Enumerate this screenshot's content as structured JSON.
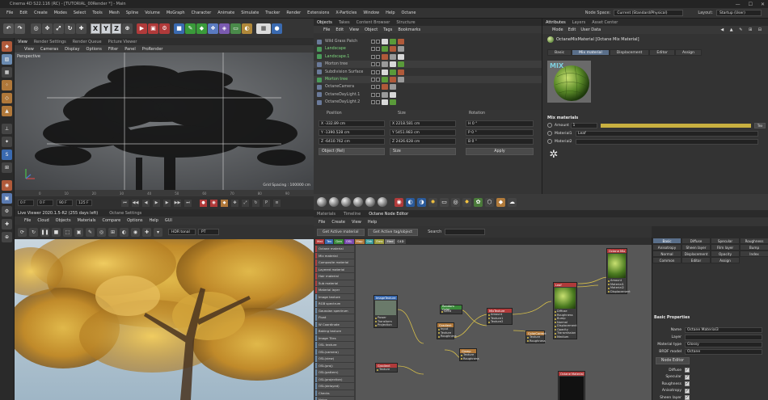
{
  "titlebar": {
    "title": "Cinema 4D S22.116 (RC) - [TUTORIAL_00Render *] - Main",
    "minimize": "—",
    "maximize": "☐",
    "close": "✕"
  },
  "menubar": {
    "items": [
      "File",
      "Edit",
      "Create",
      "Modes",
      "Select",
      "Tools",
      "Mesh",
      "Spline",
      "Volume",
      "MoGraph",
      "Character",
      "Animate",
      "Simulate",
      "Tracker",
      "Render",
      "Extensions",
      "X-Particles",
      "Window",
      "Help",
      "Octane"
    ],
    "node_space_label": "Node Space:",
    "node_space_value": "Current (Standard/Physical)",
    "layout_label": "Layout:",
    "layout_value": "Startup (User)"
  },
  "toolbar": {
    "x": "X",
    "y": "Y",
    "z": "Z"
  },
  "viewport": {
    "tabs": [
      "View",
      "Render Settings",
      "Render Queue",
      "Picture Viewer"
    ],
    "menu": [
      "View",
      "Cameras",
      "Display",
      "Options",
      "Filter",
      "Panel",
      "ProRender"
    ],
    "label": "Perspective",
    "grid_spacing": "Grid Spacing : 100000 cm"
  },
  "timeline": {
    "ticks": [
      "0",
      "10",
      "20",
      "30",
      "40",
      "50",
      "60",
      "70",
      "80",
      "90"
    ],
    "start": "0 F",
    "current": "0 F",
    "fps": "90 F",
    "end": "125 F"
  },
  "liveviewer": {
    "tabs": [
      "Live Viewer 2020.1.5-R2 (255 days left)",
      "Octane Settings"
    ],
    "menu": [
      "File",
      "Cloud",
      "Objects",
      "Materials",
      "Compare",
      "Options",
      "Help",
      "GUI"
    ],
    "hdr_mode": "HDR tonal",
    "pt_mode": "PT"
  },
  "objects": {
    "tabs": [
      "Objects",
      "Takes",
      "Content Browser",
      "Structure",
      "Layers",
      "Asset Center"
    ],
    "menu": [
      "File",
      "Edit",
      "View",
      "Object",
      "Tags",
      "Bookmarks"
    ],
    "rows": [
      {
        "name": "Wild Grass Patch",
        "color": "#b8b8b8"
      },
      {
        "name": "Landscape",
        "color": "#7ed87e"
      },
      {
        "name": "Landscape.1",
        "color": "#7ed87e"
      },
      {
        "name": "Morton tree",
        "color": "#b8b8b8"
      },
      {
        "name": "Subdivision Surface",
        "color": "#b8b8b8"
      },
      {
        "name": "Morton tree",
        "color": "#7ed87e"
      },
      {
        "name": "OctaneCamera",
        "color": "#b8b8b8"
      },
      {
        "name": "OctaneDayLight.1",
        "color": "#b8b8b8"
      },
      {
        "name": "OctaneDayLight.2",
        "color": "#b8b8b8"
      }
    ]
  },
  "coords": {
    "position_label": "Position",
    "size_label": "Size",
    "rotation_label": "Rotation",
    "position": [
      "X  -332.89 cm",
      "Y  -1390.528 cm",
      "Z  -6410.762 cm"
    ],
    "size": [
      "X  2218.581 cm",
      "Y  5451.983 cm",
      "Z  2426.628 cm"
    ],
    "rotation": [
      "H  0 °",
      "P  0 °",
      "B  0 °"
    ],
    "mode_object": "Object (Rel)",
    "mode_size": "Size",
    "apply": "Apply"
  },
  "attributes": {
    "tabs": [
      "Attributes",
      "Layers",
      "Asset Center"
    ],
    "menu": [
      "Mode",
      "Edit",
      "User Data"
    ],
    "title": "OctaneMixMaterial [Octane Mix Material]",
    "mattabs": [
      "Basic",
      "Mix material",
      "Displacement",
      "Editor",
      "Assign"
    ],
    "preview_label": "MIX",
    "mix_header": "Mix materials",
    "amount_label": "Amount",
    "amount_value": "1",
    "tex_button": "Tex",
    "material1_label": "Material1",
    "material1_value": "Leaf",
    "material2_label": "Material2"
  },
  "nodeeditor": {
    "tabs": [
      "Materials",
      "Timeline",
      "Octane Node Editor"
    ],
    "menu": [
      "File",
      "Create",
      "View",
      "Help"
    ],
    "get_active_material": "Get Active material",
    "get_active_tag": "Get Active tag/object",
    "search_label": "Search",
    "categories": [
      {
        "label": "Mat",
        "color": "#b03a3a"
      },
      {
        "label": "Tex",
        "color": "#3a6ab0"
      },
      {
        "label": "Gen",
        "color": "#3a8a3a"
      },
      {
        "label": "OSL",
        "color": "#7a4ab0"
      },
      {
        "label": "Map",
        "color": "#b0783a"
      },
      {
        "label": "Oth",
        "color": "#3a9a9a"
      },
      {
        "label": "Ems",
        "color": "#9a9a3a"
      },
      {
        "label": "Med",
        "color": "#6a6a6a"
      },
      {
        "label": "C4D",
        "color": "#444444"
      }
    ],
    "material_list": [
      "Octane material",
      "Mix material",
      "Composite material",
      "Layered material",
      "Hair material",
      "Sub material",
      "Material layer",
      "Image texture",
      "RGB spectrum",
      "Gaussian spectrum",
      "Float",
      "W Coordinate",
      "Baking texture",
      "Image Tiles",
      "OSL texture",
      "OSL(camera)",
      "OSL(view)",
      "OSL(proj)",
      "OSL(pattern)",
      "OSL(projection)",
      "OSL(delayed)",
      "Checks",
      "Noise"
    ],
    "nodes": [
      {
        "title": "ImageTexture",
        "color": "#3a6ab0",
        "ports": [
          "Power",
          "Transform",
          "Projection"
        ]
      },
      {
        "title": "Random Color",
        "color": "#3a8a3a",
        "ports": [
          "Seed"
        ]
      },
      {
        "title": "Gradient",
        "color": "#b0783a",
        "ports": [
          "Input",
          "Texture",
          "Roughness"
        ]
      },
      {
        "title": "MixTexture",
        "color": "#b03a3a",
        "ports": [
          "Amount",
          "Texture1",
          "Texture2"
        ]
      },
      {
        "title": "Leaf",
        "color": "#b03a3a",
        "ports": [
          "Diffuse",
          "Roughness",
          "Bump",
          "Normal",
          "Displacement",
          "Opacity",
          "Transmission",
          "Medium"
        ]
      },
      {
        "title": "Octane Mix",
        "color": "#b03a3a",
        "ports": [
          "Amount",
          "Material1",
          "Material2",
          "Displacement"
        ]
      },
      {
        "title": "ColorCorrect",
        "color": "#b0783a",
        "ports": [
          "Texture",
          "Roughness"
        ]
      },
      {
        "title": "Clamp",
        "color": "#b0783a",
        "ports": [
          "Texture",
          "Roughness"
        ]
      },
      {
        "title": "Gradient",
        "color": "#b03a3a",
        "ports": [
          "Texture"
        ]
      },
      {
        "title": "Octane Material",
        "color": "#b03a3a",
        "ports": []
      }
    ]
  },
  "nodeprops": {
    "tabs": [
      "Basic",
      "Diffuse",
      "Specular",
      "Roughness",
      "Anisotropy",
      "Sheen layer",
      "Film layer",
      "Bump",
      "Normal",
      "Displacement",
      "Opacity",
      "Index",
      "Common",
      "Editor",
      "Assign"
    ],
    "header": "Basic Properties",
    "name_label": "Name",
    "name_value": "Octane Material3",
    "layer_label": "Layer",
    "material_type_label": "Material type",
    "material_type_value": "Glossy",
    "brdf_label": "BRDF model",
    "brdf_value": "Octane",
    "node_editor_button": "Node Editor",
    "checks": [
      "Diffuse",
      "Specular",
      "Roughness",
      "Anisotropy",
      "Sheen layer"
    ]
  }
}
